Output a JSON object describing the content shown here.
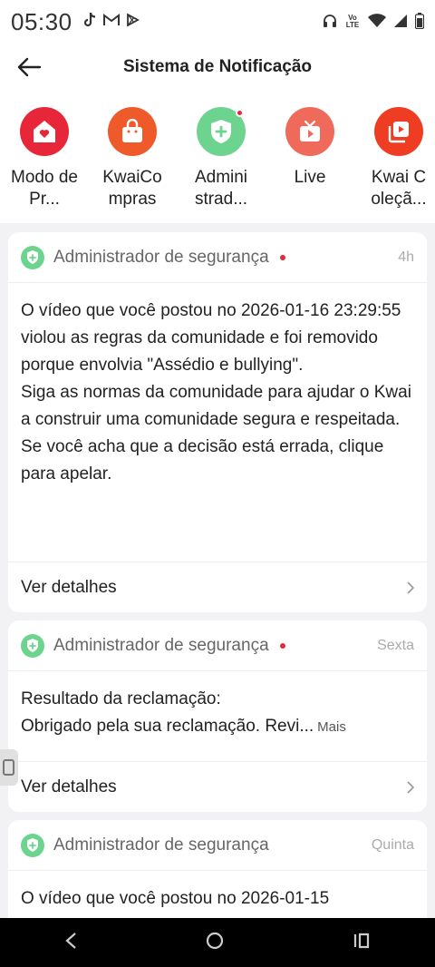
{
  "status_bar": {
    "time": "05:30",
    "left_icons": [
      "tiktok-icon",
      "gmail-icon",
      "play-icon"
    ],
    "right_icons": [
      "headset-icon",
      "volte-icon",
      "wifi-icon",
      "signal-icon",
      "battery-icon"
    ],
    "volte_text": "Vo LTE"
  },
  "header": {
    "title": "Sistema de Notificação"
  },
  "shortcuts": [
    {
      "label": "Modo de Pr...",
      "color": "#e8263a",
      "icon": "home-heart-icon"
    },
    {
      "label": "KwaiCo mpras",
      "color": "#ef5a2a",
      "icon": "shopping-bag-icon"
    },
    {
      "label": "Admini strad...",
      "color": "#6dd48f",
      "icon": "shield-plus-icon",
      "unread": true
    },
    {
      "label": "Live",
      "color": "#ef6a5a",
      "icon": "tv-icon"
    },
    {
      "label": "Kwai C oleçã...",
      "color": "#ee3d22",
      "icon": "video-collection-icon"
    }
  ],
  "notifications": [
    {
      "sender": "Administrador de segurança",
      "unread": true,
      "time": "4h",
      "paragraphs": [
        "O vídeo que você postou no 2026-01-16 23:29:55 violou as regras da comunidade e foi removido porque envolvia \"Assédio e bullying\".",
        "Siga as normas da comunidade para ajudar o Kwai a construir uma comunidade segura e respeitada.",
        "Se você acha que a decisão está errada, clique para apelar."
      ],
      "action": "Ver detalhes"
    },
    {
      "sender": "Administrador de segurança",
      "unread": true,
      "time": "Sexta",
      "paragraphs": [
        "Resultado da reclamação:",
        "Obrigado pela sua reclamação. Revi..."
      ],
      "more": "Mais",
      "action": "Ver detalhes"
    },
    {
      "sender": "Administrador de segurança",
      "unread": false,
      "time": "Quinta",
      "paragraphs": [
        "O vídeo que você postou no 2026-01-15"
      ]
    }
  ],
  "nav": [
    "back-icon",
    "home-icon",
    "recents-icon"
  ]
}
